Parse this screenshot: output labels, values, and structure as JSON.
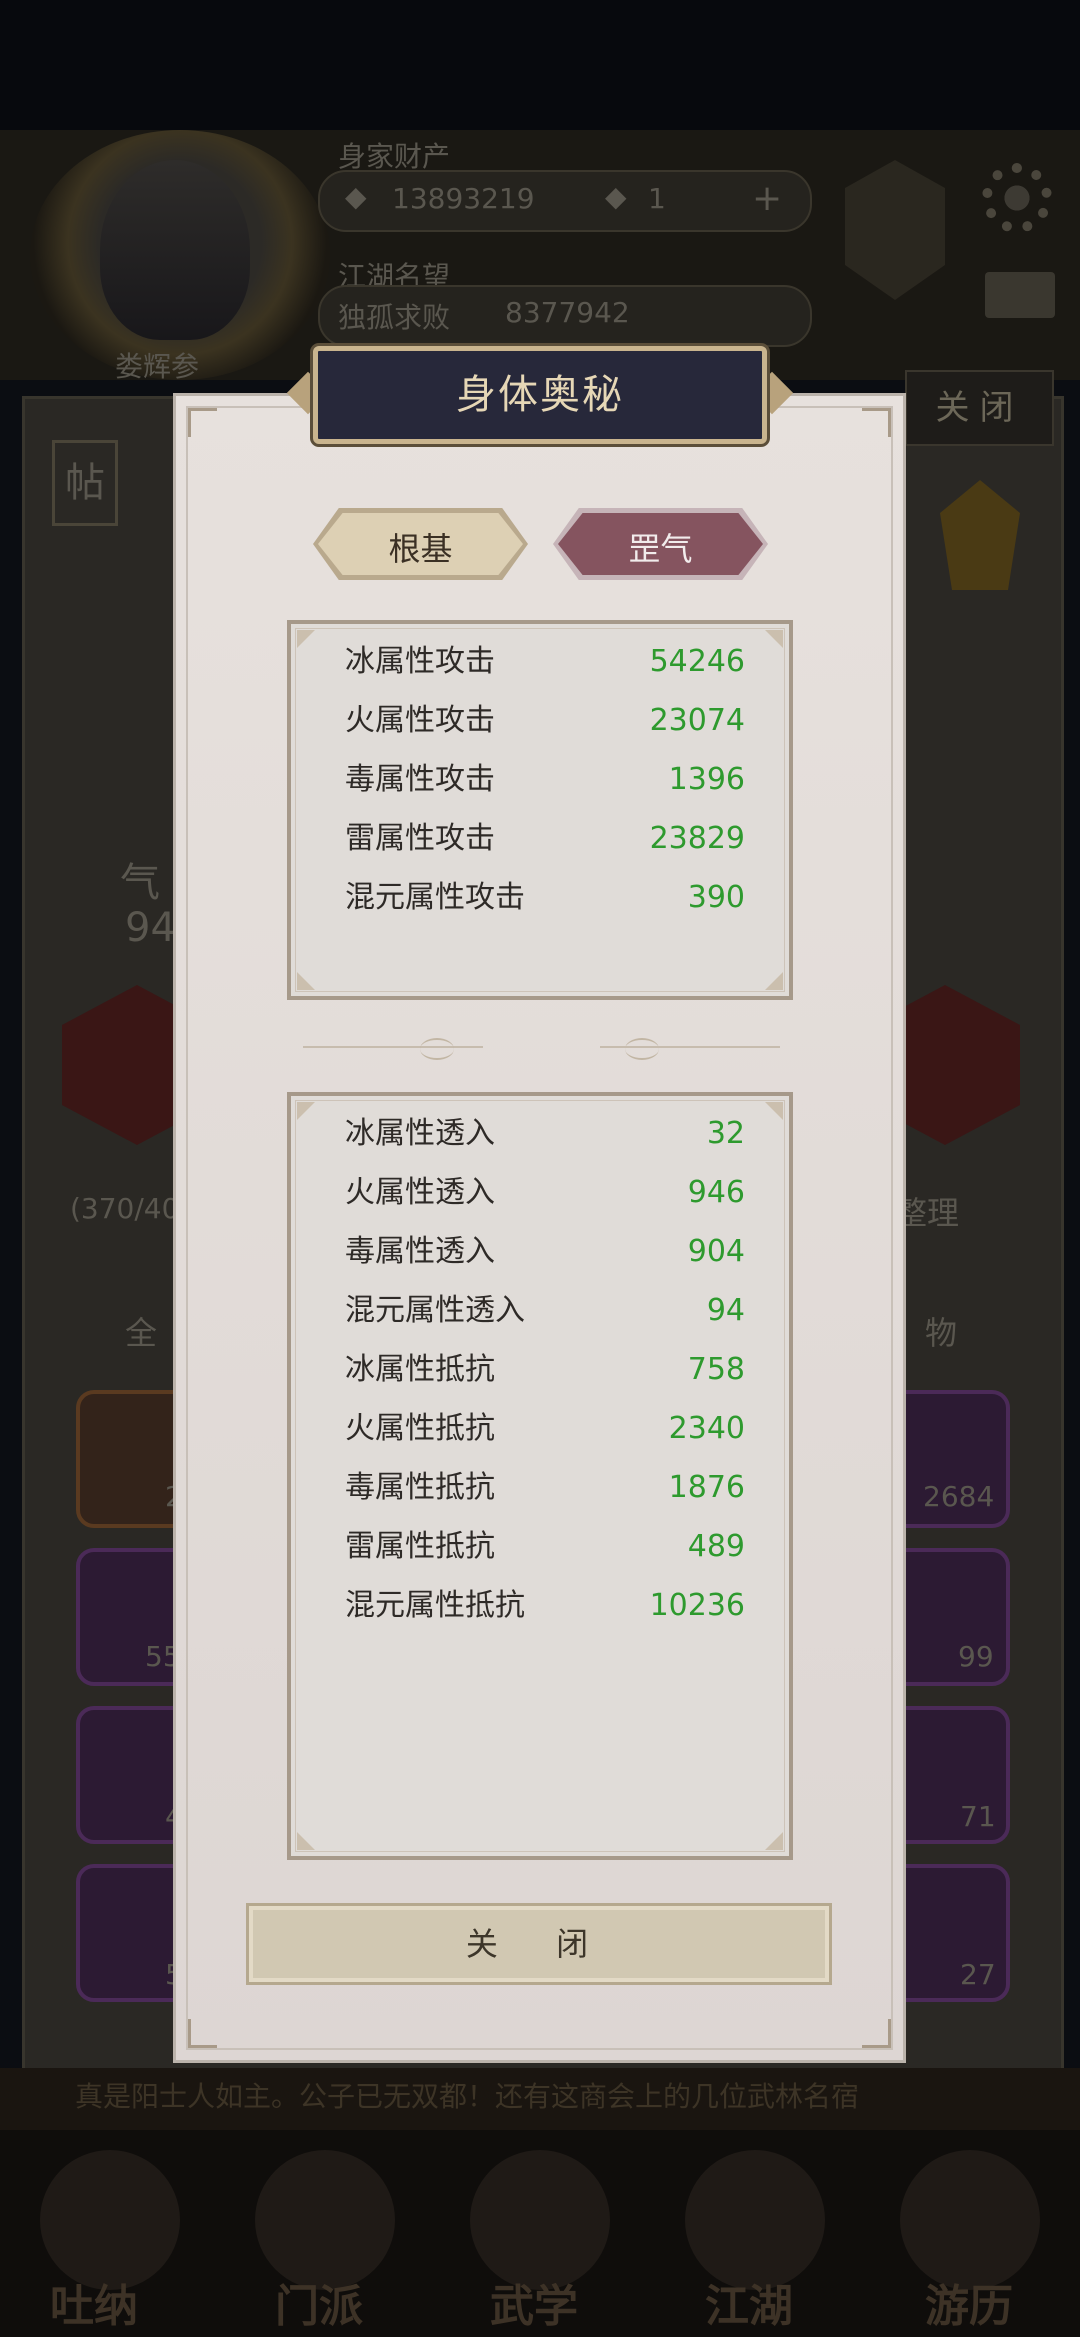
{
  "background": {
    "assets_label": "身家财产",
    "silver": "13893219",
    "jade": "1",
    "fame_label": "江湖名望",
    "player_name": "独孤求败",
    "fame_value": "8377942",
    "avatar_label": "娄辉参",
    "close_tab": "关闭",
    "post_label": "帖",
    "bag_count": "(370/40",
    "sort_button": "整理",
    "filter_all": "全",
    "filter_items": "物",
    "qi_label": "气",
    "qi_value": "94",
    "item_counts": [
      "2684",
      "99",
      "71",
      "27"
    ],
    "left_item_counts": [
      "2",
      "55",
      "4",
      "5"
    ],
    "scroll_text": "真是阳士人如主。公子已无双都！还有这商会上的几位武林名宿",
    "nav": [
      "吐纳",
      "门派",
      "武学",
      "江湖",
      "游历"
    ]
  },
  "modal": {
    "title": "身体奥秘",
    "tabs": [
      {
        "label": "根基",
        "active": false
      },
      {
        "label": "罡气",
        "active": true
      }
    ],
    "attack_stats": [
      {
        "label": "冰属性攻击",
        "value": "54246"
      },
      {
        "label": "火属性攻击",
        "value": "23074"
      },
      {
        "label": "毒属性攻击",
        "value": "1396"
      },
      {
        "label": "雷属性攻击",
        "value": "23829"
      },
      {
        "label": "混元属性攻击",
        "value": "390"
      }
    ],
    "defense_stats": [
      {
        "label": "冰属性透入",
        "value": "32"
      },
      {
        "label": "火属性透入",
        "value": "946"
      },
      {
        "label": "毒属性透入",
        "value": "904"
      },
      {
        "label": "混元属性透入",
        "value": "94"
      },
      {
        "label": "冰属性抵抗",
        "value": "758"
      },
      {
        "label": "火属性抵抗",
        "value": "2340"
      },
      {
        "label": "毒属性抵抗",
        "value": "1876"
      },
      {
        "label": "雷属性抵抗",
        "value": "489"
      },
      {
        "label": "混元属性抵抗",
        "value": "10236"
      }
    ],
    "close_button": "关 闭"
  },
  "colors": {
    "value_green": "#2e9a2e",
    "title_bg": "#27283a",
    "active_tab": "#85545f"
  }
}
